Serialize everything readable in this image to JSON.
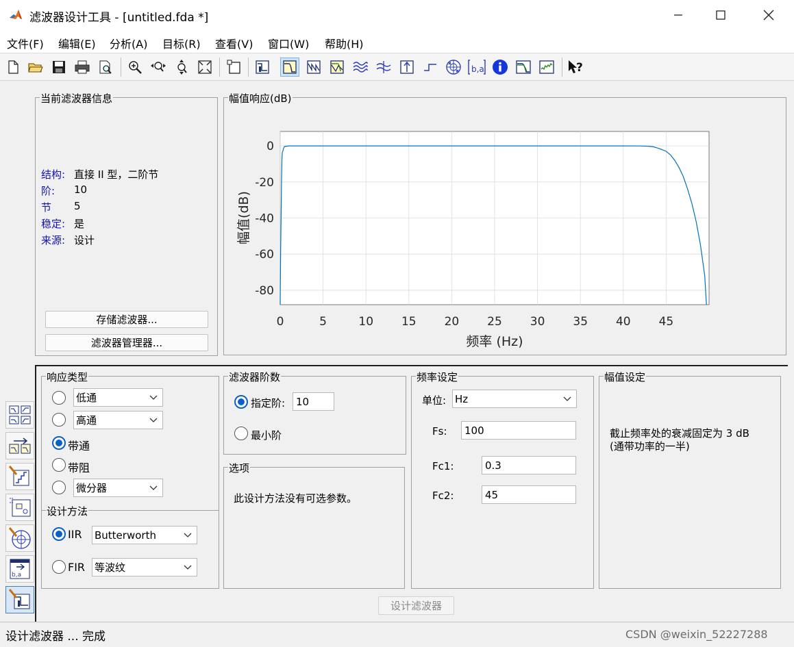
{
  "window": {
    "title": "滤波器设计工具 -  [untitled.fda *]"
  },
  "menu": [
    "文件(F)",
    "编辑(E)",
    "分析(A)",
    "目标(R)",
    "查看(V)",
    "窗口(W)",
    "帮助(H)"
  ],
  "toolbar": {
    "icons": [
      "new-icon",
      "open-icon",
      "save-icon",
      "print-icon",
      "print-preview-icon",
      "zoom-in-icon",
      "zoom-x-icon",
      "zoom-y-icon",
      "full-view-icon",
      "new-figure-icon",
      "filter-specs-icon",
      "magnitude-response-icon",
      "phase-response-icon",
      "magnitude-phase-icon",
      "group-delay-icon",
      "phase-delay-icon",
      "impulse-response-icon",
      "step-response-icon",
      "pole-zero-icon",
      "filter-coefficients-icon",
      "filter-info-icon",
      "magnitude-estimate-icon",
      "round-off-noise-icon",
      "whats-this-icon"
    ]
  },
  "filter_info": {
    "title": "当前滤波器信息",
    "rows": [
      {
        "label": "结构:",
        "value": "直接 II 型，二阶节"
      },
      {
        "label": "阶:",
        "value": "10"
      },
      {
        "label": "节",
        "value": "5"
      },
      {
        "label": "稳定:",
        "value": "是"
      },
      {
        "label": "来源:",
        "value": "设计"
      }
    ],
    "store_button": "存储滤波器...",
    "manager_button": "滤波器管理器..."
  },
  "plot": {
    "title": "幅值响应(dB)"
  },
  "chart_data": {
    "type": "line",
    "xlabel": "频率 (Hz)",
    "ylabel": "幅值(dB)",
    "xlim": [
      0,
      50
    ],
    "ylim": [
      -88,
      8
    ],
    "xticks": [
      "0",
      "5",
      "10",
      "15",
      "20",
      "25",
      "30",
      "35",
      "40",
      "45"
    ],
    "yticks": [
      "0",
      "-20",
      "-40",
      "-60",
      "-80"
    ],
    "grid": true,
    "line_color": "#0072bd",
    "series": [
      {
        "x": [
          0.0,
          0.05,
          0.1,
          0.15,
          0.2,
          0.25,
          0.3,
          0.4,
          0.5,
          1,
          2,
          5,
          10,
          20,
          30,
          40,
          42,
          43,
          43.5,
          44,
          44.5,
          45,
          45.5,
          46,
          46.5,
          47,
          47.5,
          48,
          48.5,
          49,
          49.5,
          49.7
        ],
        "y": [
          -88,
          -60,
          -40,
          -20,
          -8,
          -3.5,
          -3,
          -1.2,
          -0.4,
          0,
          0,
          0,
          0,
          0,
          0,
          0,
          -0.05,
          -0.2,
          -0.5,
          -1.2,
          -2,
          -3,
          -5,
          -8,
          -12,
          -17,
          -24,
          -32,
          -42,
          -55,
          -72,
          -88
        ]
      }
    ]
  },
  "response_type": {
    "title": "响应类型",
    "options": [
      {
        "label": "低通",
        "selected": false,
        "select_value": "低通"
      },
      {
        "label": "高通",
        "selected": false,
        "select_value": "高通"
      },
      {
        "label": "带通",
        "selected": true
      },
      {
        "label": "带阻",
        "selected": false
      },
      {
        "label": "微分器",
        "selected": false,
        "select_value": "微分器"
      }
    ]
  },
  "design_method": {
    "title": "设计方法",
    "iir_label": "IIR",
    "iir_value": "Butterworth",
    "fir_label": "FIR",
    "fir_value": "等波纹"
  },
  "filter_order": {
    "title": "滤波器阶数",
    "specify_label": "指定阶:",
    "specify_value": "10",
    "minimum_label": "最小阶"
  },
  "options": {
    "title": "选项",
    "text": "此设计方法没有可选参数。"
  },
  "freq_spec": {
    "title": "频率设定",
    "units_label": "单位:",
    "units_value": "Hz",
    "fs_label": "Fs:",
    "fs_value": "100",
    "fc1_label": "Fc1:",
    "fc1_value": "0.3",
    "fc2_label": "Fc2:",
    "fc2_value": "45"
  },
  "mag_spec": {
    "title": "幅值设定",
    "line1": "截止频率处的衰减固定为 3 dB",
    "line2": "(通带功率的一半)"
  },
  "design_button": "设计滤波器",
  "status": "设计滤波器 ... 完成",
  "watermark": "CSDN @weixin_52227288"
}
